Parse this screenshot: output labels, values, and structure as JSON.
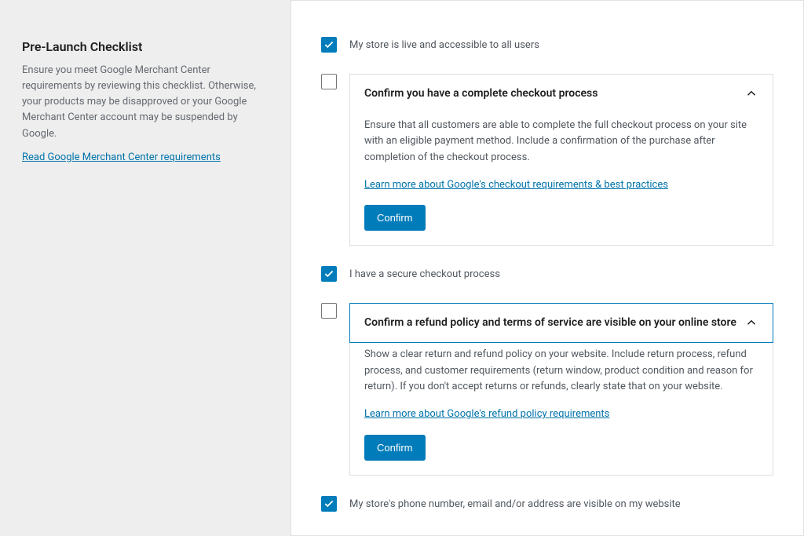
{
  "sidebar": {
    "title": "Pre-Launch Checklist",
    "description": "Ensure you meet Google Merchant Center requirements by reviewing this checklist. Otherwise, your products may be disapproved or your Google Merchant Center account may be suspended by Google.",
    "link_text": "Read Google Merchant Center requirements"
  },
  "items": {
    "store_live": {
      "label": "My store is live and accessible to all users"
    },
    "checkout": {
      "title": "Confirm you have a complete checkout process",
      "body": "Ensure that all customers are able to complete the full checkout process on your site with an eligible payment method. Include a confirmation of the purchase after completion of the checkout process.",
      "link": "Learn more about Google's checkout requirements & best practices",
      "button": "Confirm"
    },
    "secure_checkout": {
      "label": "I have a secure checkout process"
    },
    "refund": {
      "title": "Confirm a refund policy and terms of service are visible on your online store",
      "body": "Show a clear return and refund policy on your website. Include return process, refund process, and customer requirements (return window, product condition and reason for return). If you don't accept returns or refunds, clearly state that on your website.",
      "link": "Learn more about Google's refund policy requirements",
      "button": "Confirm"
    },
    "contact": {
      "label": "My store's phone number, email and/or address are visible on my website"
    }
  }
}
